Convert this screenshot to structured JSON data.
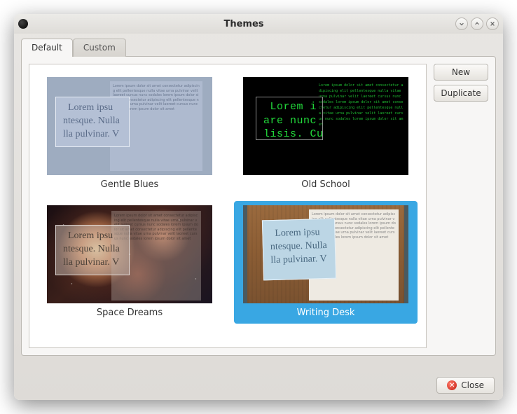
{
  "window": {
    "title": "Themes"
  },
  "tabs": [
    {
      "label": "Default",
      "active": true
    },
    {
      "label": "Custom",
      "active": false
    }
  ],
  "buttons": {
    "new": "New",
    "duplicate": "Duplicate",
    "close": "Close"
  },
  "themes": [
    {
      "name": "Gentle Blues",
      "selected": false
    },
    {
      "name": "Old School",
      "selected": false
    },
    {
      "name": "Space Dreams",
      "selected": false
    },
    {
      "name": "Writing Desk",
      "selected": true
    }
  ],
  "preview_text": {
    "serif_lines": "  Lorem ipsu\nntesque. Nulla\nlla pulvinar. V",
    "mono_lines": " Lorem i\nare nunc s\nlisis. Cu",
    "filler": "Lorem ipsum dolor sit amet consectetur adipiscing elit pellentesque nulla vitae urna pulvinar velit laoreet cursus nunc sodales lorem ipsum dolor sit amet consectetur adipiscing elit pellentesque nulla vitae urna pulvinar velit laoreet cursus nunc sodales lorem ipsum dolor sit amet"
  }
}
